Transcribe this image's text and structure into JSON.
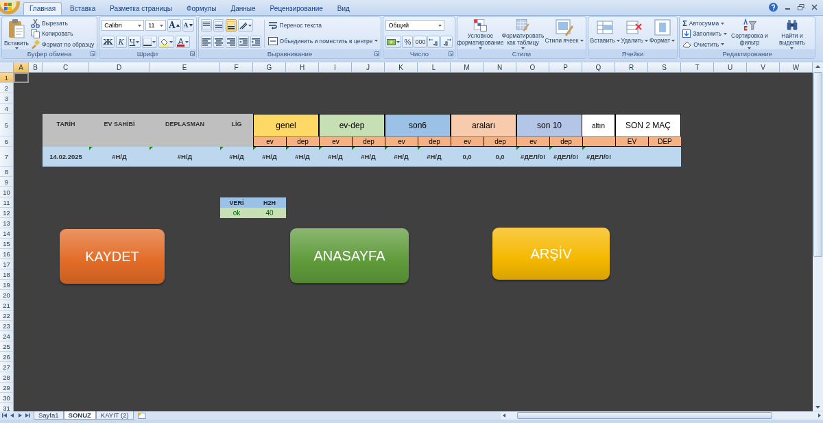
{
  "ribbon_tabs": [
    {
      "label": "Главная",
      "selected": true
    },
    {
      "label": "Вставка",
      "selected": false
    },
    {
      "label": "Разметка страницы",
      "selected": false
    },
    {
      "label": "Формулы",
      "selected": false
    },
    {
      "label": "Данные",
      "selected": false
    },
    {
      "label": "Рецензирование",
      "selected": false
    },
    {
      "label": "Вид",
      "selected": false
    }
  ],
  "clipboard": {
    "label": "Буфер обмена",
    "paste": "Вставить",
    "cut": "Вырезать",
    "copy": "Копировать",
    "format_painter": "Формат по образцу"
  },
  "font": {
    "label": "Шрифт",
    "font_name": "Calibri",
    "font_size": "11",
    "grow": "A",
    "shrink": "A",
    "bold": "Ж",
    "italic": "К",
    "underline": "Ч",
    "font_color": "A"
  },
  "alignment": {
    "label": "Выравнивание",
    "vertical_align": [
      {
        "selected": false
      },
      {
        "selected": false
      },
      {
        "selected": true
      }
    ],
    "wrap_text": "Перенос текста",
    "merge_center": "Объединить и поместить в центре"
  },
  "number": {
    "label": "Число",
    "format": "Общий",
    "percent": "%",
    "thousands": "000"
  },
  "styles": {
    "label": "Стили",
    "conditional": "Условное форматирование",
    "format_table": "Форматировать как таблицу",
    "cell_styles": "Стили ячеек"
  },
  "cells": {
    "label": "Ячейки",
    "insert": "Вставить",
    "delete": "Удалить",
    "format": "Формат"
  },
  "editing": {
    "label": "Редактирование",
    "autosum_symbol": "Σ",
    "autosum": "Автосумма",
    "fill": "Заполнить",
    "clear": "Очистить",
    "sort": "Сортировка и фильтр",
    "find": "Найти и выделить"
  },
  "columns": [
    {
      "label": "A",
      "selected": true
    },
    {
      "label": "B",
      "selected": false
    },
    {
      "label": "C",
      "selected": false
    },
    {
      "label": "D",
      "selected": false
    },
    {
      "label": "E",
      "selected": false
    },
    {
      "label": "F",
      "selected": false
    },
    {
      "label": "G",
      "selected": false
    },
    {
      "label": "H",
      "selected": false
    },
    {
      "label": "I",
      "selected": false
    },
    {
      "label": "J",
      "selected": false
    },
    {
      "label": "K",
      "selected": false
    },
    {
      "label": "L",
      "selected": false
    },
    {
      "label": "M",
      "selected": false
    },
    {
      "label": "N",
      "selected": false
    },
    {
      "label": "O",
      "selected": false
    },
    {
      "label": "P",
      "selected": false
    },
    {
      "label": "Q",
      "selected": false
    },
    {
      "label": "R",
      "selected": false
    },
    {
      "label": "S",
      "selected": false
    },
    {
      "label": "T",
      "selected": false
    },
    {
      "label": "U",
      "selected": false
    },
    {
      "label": "V",
      "selected": false
    },
    {
      "label": "W",
      "selected": false
    }
  ],
  "rows": [
    {
      "label": "1",
      "selected": true
    },
    {
      "label": "2",
      "selected": false
    },
    {
      "label": "3",
      "selected": false
    },
    {
      "label": "4",
      "selected": false
    },
    {
      "label": "5",
      "selected": false
    },
    {
      "label": "6",
      "selected": false
    },
    {
      "label": "7",
      "selected": false
    },
    {
      "label": "8",
      "selected": false
    },
    {
      "label": "9",
      "selected": false
    },
    {
      "label": "10",
      "selected": false
    },
    {
      "label": "11",
      "selected": false
    },
    {
      "label": "12",
      "selected": false
    },
    {
      "label": "13",
      "selected": false
    },
    {
      "label": "14",
      "selected": false
    },
    {
      "label": "15",
      "selected": false
    },
    {
      "label": "16",
      "selected": false
    },
    {
      "label": "17",
      "selected": false
    },
    {
      "label": "18",
      "selected": false
    },
    {
      "label": "19",
      "selected": false
    },
    {
      "label": "20",
      "selected": false
    },
    {
      "label": "21",
      "selected": false
    },
    {
      "label": "22",
      "selected": false
    },
    {
      "label": "23",
      "selected": false
    },
    {
      "label": "24",
      "selected": false
    },
    {
      "label": "25",
      "selected": false
    },
    {
      "label": "26",
      "selected": false
    },
    {
      "label": "27",
      "selected": false
    },
    {
      "label": "28",
      "selected": false
    },
    {
      "label": "29",
      "selected": false
    },
    {
      "label": "30",
      "selected": false
    },
    {
      "label": "31",
      "selected": false
    }
  ],
  "table": {
    "headers": [
      {
        "kind": "plain",
        "label": "TARİH",
        "color": "#bfbfbf"
      },
      {
        "kind": "plain",
        "label": "EV SAHİBİ",
        "color": "#bfbfbf"
      },
      {
        "kind": "plain",
        "label": "DEPLASMAN",
        "color": "#bfbfbf"
      },
      {
        "kind": "plain",
        "label": "LİG",
        "color": "#bfbfbf"
      },
      {
        "kind": "group",
        "label": "genel",
        "color": "#ffd966",
        "sub": [
          "ev",
          "dep"
        ]
      },
      {
        "kind": "group",
        "label": "ev-dep",
        "color": "#c6e0b4",
        "sub": [
          "ev",
          "dep"
        ]
      },
      {
        "kind": "group",
        "label": "son6",
        "color": "#9bc2e6",
        "sub": [
          "ev",
          "dep"
        ]
      },
      {
        "kind": "group",
        "label": "araları",
        "color": "#f8cbad",
        "sub": [
          "ev",
          "dep"
        ]
      },
      {
        "kind": "group",
        "label": "son 10",
        "color": "#b4c6e7",
        "sub": [
          "ev",
          "dep"
        ]
      },
      {
        "kind": "blank",
        "label": "altın",
        "color": "#ffffff"
      },
      {
        "kind": "group",
        "label": "SON 2 MAÇ",
        "color": "#ffffff",
        "sub": [
          "EV",
          "DEP"
        ]
      }
    ],
    "values": [
      {
        "text": "14.02.2025",
        "flag": false
      },
      {
        "text": "#Н/Д",
        "flag": true
      },
      {
        "text": "#Н/Д",
        "flag": true
      },
      {
        "text": "#Н/Д",
        "flag": true
      },
      {
        "text": "#Н/Д",
        "flag": true
      },
      {
        "text": "#Н/Д",
        "flag": true
      },
      {
        "text": "#Н/Д",
        "flag": true
      },
      {
        "text": "#Н/Д",
        "flag": true
      },
      {
        "text": "#Н/Д",
        "flag": true
      },
      {
        "text": "#Н/Д",
        "flag": true
      },
      {
        "text": "0,0",
        "flag": false
      },
      {
        "text": "0,0",
        "flag": false
      },
      {
        "text": "#ДЕЛ/0!",
        "flag": true
      },
      {
        "text": "#ДЕЛ/0!",
        "flag": true
      },
      {
        "text": "#ДЕЛ/0!",
        "flag": true
      }
    ]
  },
  "h2h_table": {
    "headers": [
      "VERİ",
      "H2H"
    ],
    "values": [
      "ok",
      "40"
    ]
  },
  "shape_buttons": [
    {
      "label": "KAYDET",
      "color": "#e26b26"
    },
    {
      "label": "ANASAYFA",
      "color": "#5f9b3b"
    },
    {
      "label": "ARŞİV",
      "color": "#f6b800"
    }
  ],
  "sheet_tabs": [
    {
      "label": "Sayfa1",
      "selected": false
    },
    {
      "label": "SONUZ",
      "selected": true
    },
    {
      "label": "KAYIT (2)",
      "selected": false
    }
  ]
}
